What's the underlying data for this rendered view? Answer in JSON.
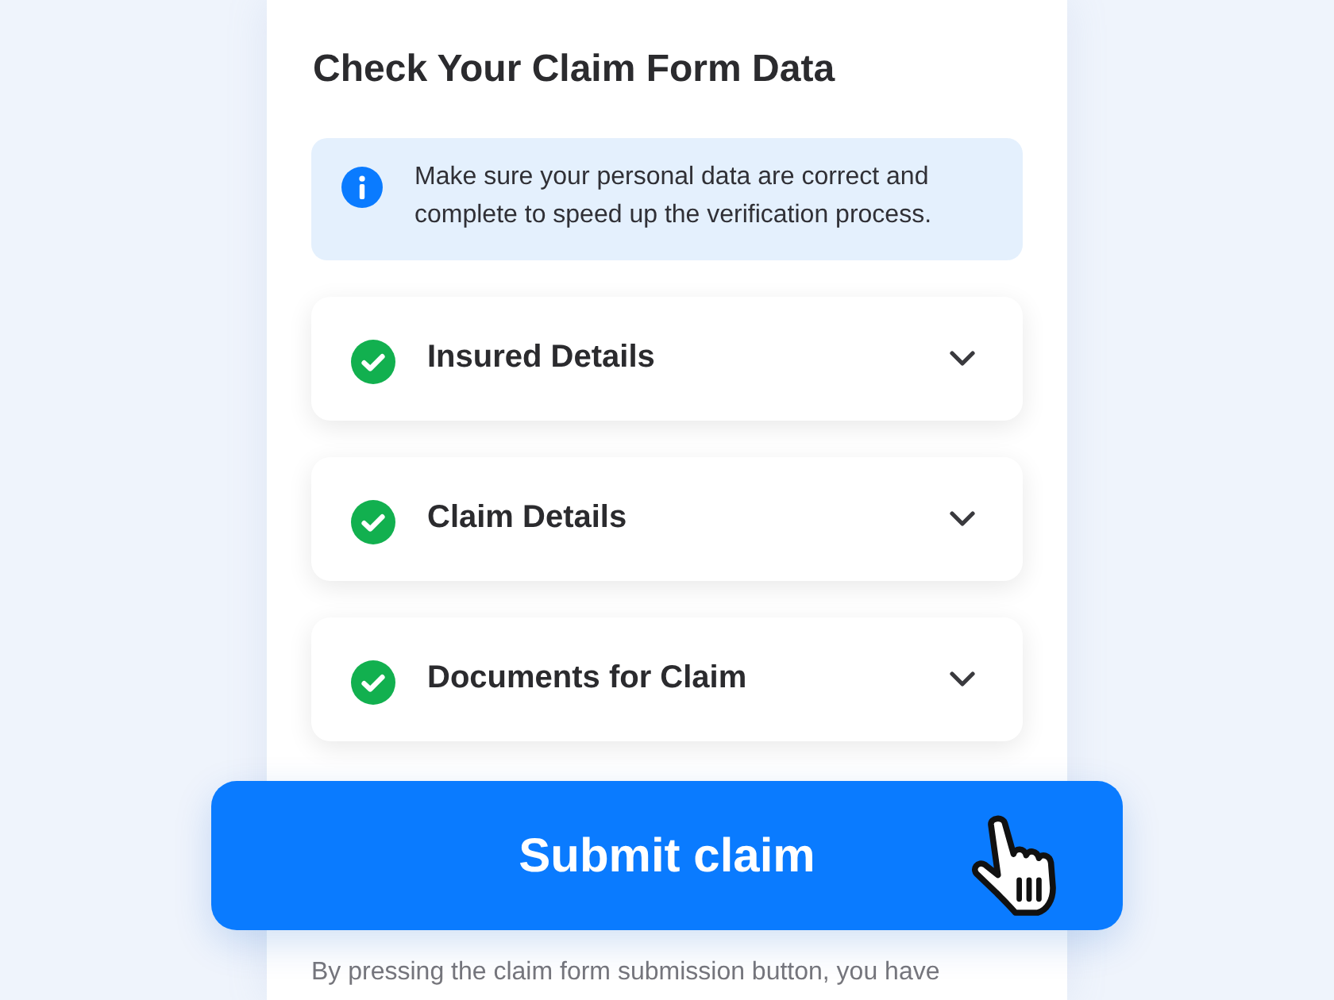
{
  "heading": "Check Your Claim Form Data",
  "info_notice": {
    "text": "Make sure your personal data are correct and complete to speed up the verification process."
  },
  "sections": [
    {
      "title": "Insured Details",
      "completed": true,
      "expanded": false
    },
    {
      "title": "Claim Details",
      "completed": true,
      "expanded": false
    },
    {
      "title": "Documents for Claim",
      "completed": true,
      "expanded": false
    }
  ],
  "submit_button": {
    "label": "Submit claim"
  },
  "footer_note": "By pressing the claim form submission button, you have"
}
